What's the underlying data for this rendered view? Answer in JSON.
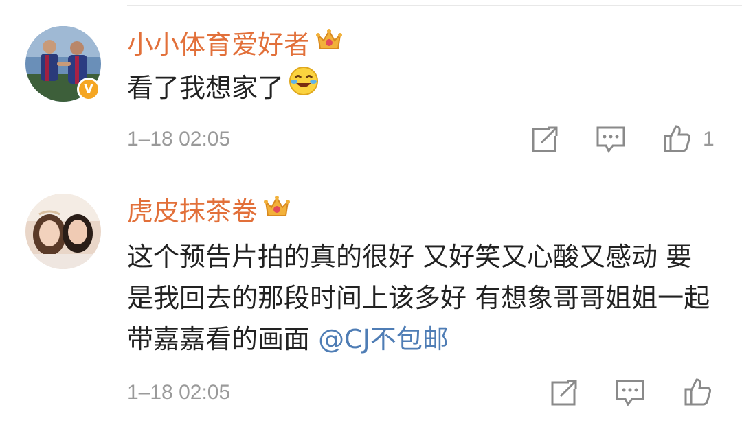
{
  "comments": [
    {
      "username": "小小体育爱好者",
      "text": "看了我想家了",
      "timestamp": "1–18 02:05",
      "like_count": "1",
      "verified_mark": "V",
      "avatar_icon": "soccer-players-avatar",
      "badge_icon": "crown-icon",
      "emoji_icon": "laughing-crying-emoji"
    },
    {
      "username": "虎皮抹茶卷",
      "text": "这个预告片拍的真的很好 又好笑又心酸又感动 要是我回去的那段时间上该多好 有想象哥哥姐姐一起带嘉嘉看的画面 ",
      "mention": "@CJ不包邮",
      "timestamp": "1–18 02:05",
      "like_count": "",
      "avatar_icon": "two-women-avatar",
      "badge_icon": "crown-icon"
    }
  ],
  "colors": {
    "username": "#e2703a",
    "mention": "#4f7db5",
    "meta": "#9a9a9a",
    "verified": "#f5a623"
  }
}
